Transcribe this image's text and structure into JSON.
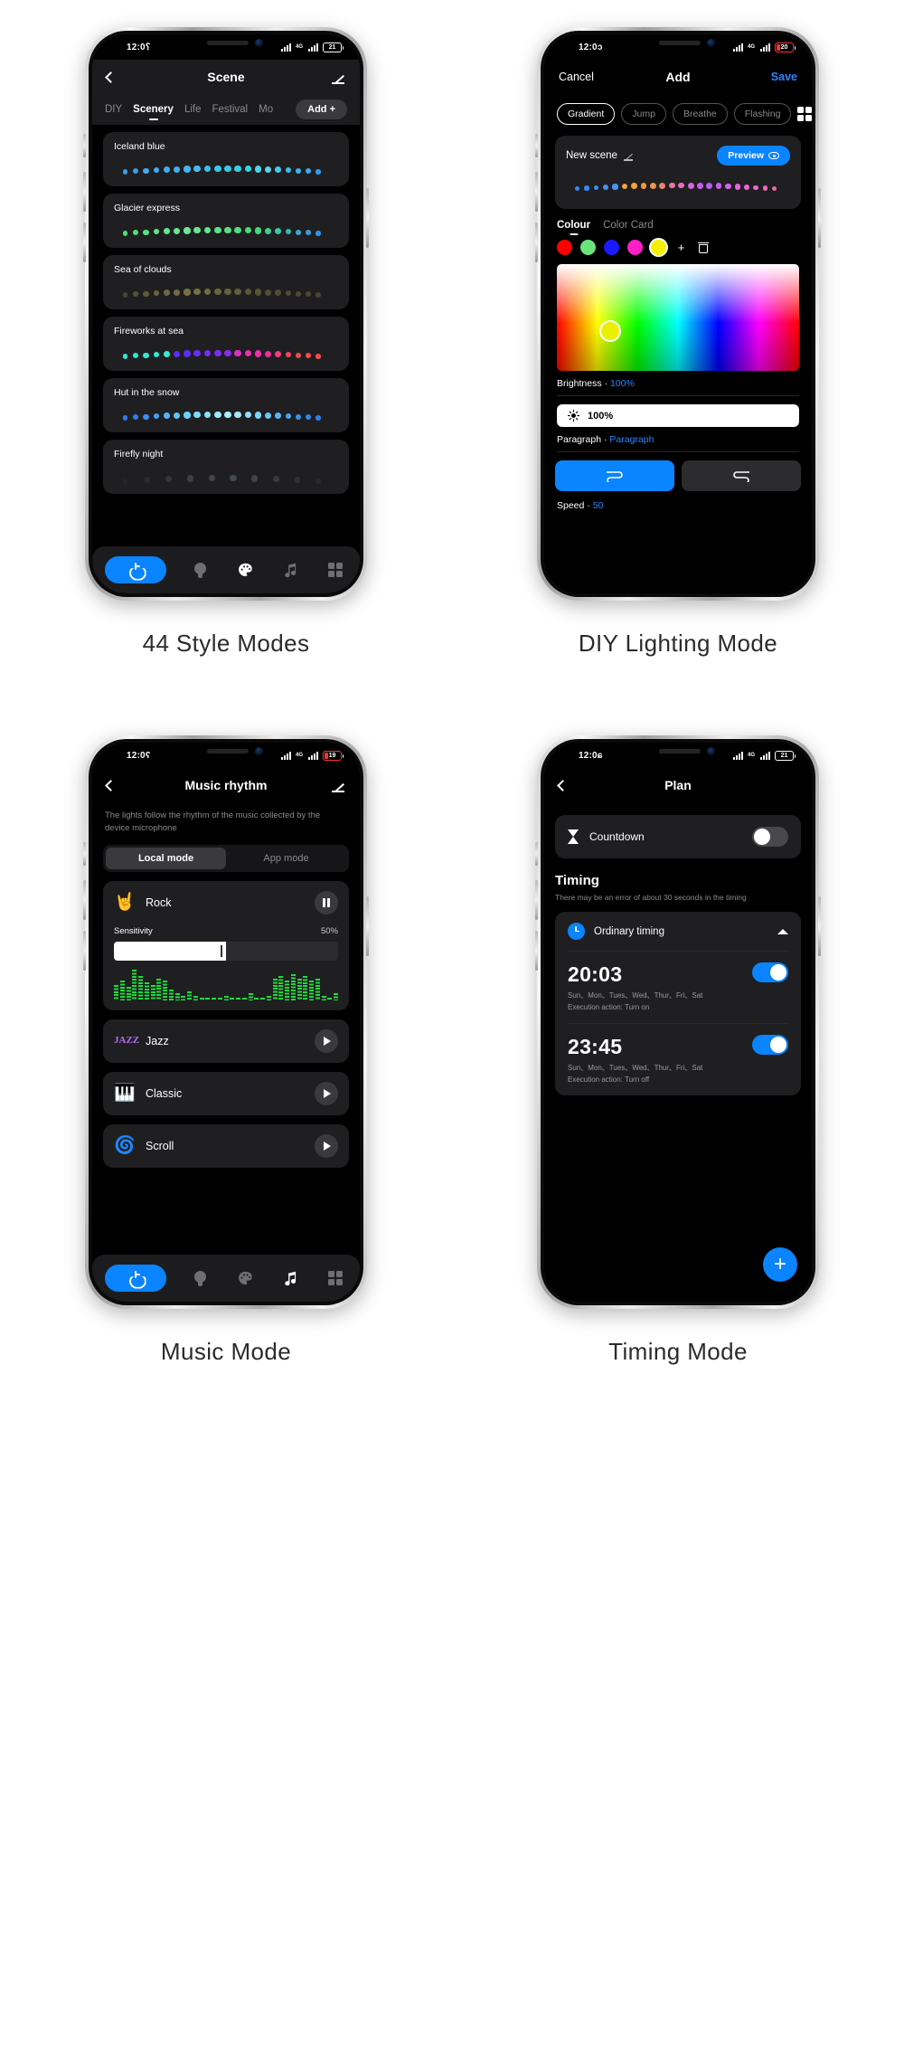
{
  "captions": {
    "p1": "44 Style Modes",
    "p2": "DIY Lighting Mode",
    "p3": "Music Mode",
    "p4": "Timing Mode"
  },
  "phone1": {
    "status": {
      "time": "12:0⸮",
      "net1": "4G",
      "net2": "4G",
      "battery": "21"
    },
    "nav": {
      "title": "Scene",
      "back_icon": "chevron-left-icon",
      "edit_icon": "pencil-icon"
    },
    "tabs": [
      {
        "label": "DIY",
        "active": false
      },
      {
        "label": "Scenery",
        "active": true
      },
      {
        "label": "Life",
        "active": false
      },
      {
        "label": "Festival",
        "active": false
      },
      {
        "label": "Mo",
        "active": false
      }
    ],
    "add_button": "Add +",
    "scenes": [
      {
        "name": "Iceland blue",
        "colors": [
          "#3a9de0",
          "#3a9de0",
          "#44a8e8",
          "#3fa9f0",
          "#43aaf0",
          "#43b1f2",
          "#45b4f2",
          "#4ab9f2",
          "#41bdf0",
          "#3ec4ef",
          "#36cbec",
          "#33d2ea",
          "#2fd8e8",
          "#4ad6ea",
          "#5bd4ee",
          "#46c8f2",
          "#39bdf5",
          "#3bb5f6",
          "#3ca8f7",
          "#2f9cf8"
        ]
      },
      {
        "name": "Glacier express",
        "colors": [
          "#4ade7a",
          "#4ade7a",
          "#55e184",
          "#5ee48b",
          "#62e58f",
          "#66e692",
          "#6ae795",
          "#68e693",
          "#63e48e",
          "#5ce289",
          "#55e084",
          "#4ede7f",
          "#47dc7a",
          "#41d97c",
          "#3ed08c",
          "#3cc59e",
          "#3ab6b6",
          "#38a8ce",
          "#369ae0",
          "#2f93f0"
        ]
      },
      {
        "name": "Sea of clouds",
        "colors": [
          "#4a4635",
          "#565138",
          "#605a3c",
          "#6a633f",
          "#6f6741",
          "#736b43",
          "#767044",
          "#747044",
          "#6f6b42",
          "#6a663f",
          "#65613c",
          "#5f5c3a",
          "#5a5737",
          "#565334",
          "#534f32",
          "#514d31",
          "#4f4b30",
          "#4d4930",
          "#4b4730",
          "#494530"
        ]
      },
      {
        "name": "Fireworks at sea",
        "colors": [
          "#2fe6d6",
          "#2fe6d6",
          "#33e8d2",
          "#35e9cf",
          "#38ebcb",
          "#5b2ef5",
          "#5b2ef5",
          "#6a2ef2",
          "#742ef0",
          "#7a2eef",
          "#8a2ee8",
          "#e22ec0",
          "#ec2eb4",
          "#ef2ea8",
          "#f12e9c",
          "#f33a7e",
          "#f54362",
          "#f6484f",
          "#f74b45",
          "#f74b45"
        ]
      },
      {
        "name": "Hut in the snow",
        "colors": [
          "#2f7ef0",
          "#2f7ef0",
          "#3a90f2",
          "#46a2f4",
          "#52b4f6",
          "#5ec6f8",
          "#6ad3fa",
          "#78ddfb",
          "#88e4fc",
          "#9aeafd",
          "#a8effd",
          "#9fe9fc",
          "#8fe0fa",
          "#7dd4f8",
          "#6ac6f6",
          "#57b6f4",
          "#46a6f2",
          "#3996f0",
          "#3086ee",
          "#2f7ef0"
        ]
      },
      {
        "name": "Firefly night",
        "colors": [
          "#23262b",
          "#2a2e33",
          "#32373d",
          "#3a4047",
          "#3f464e",
          "#424a52",
          "#3d444c",
          "#353b42",
          "#2d3238",
          "#262a2f"
        ]
      }
    ],
    "tabbar": [
      {
        "icon": "power-icon",
        "active": true
      },
      {
        "icon": "bulb-icon",
        "active": false
      },
      {
        "icon": "palette-icon",
        "active": true
      },
      {
        "icon": "music-note-icon",
        "active": false
      },
      {
        "icon": "grid-icon",
        "active": false
      }
    ]
  },
  "phone2": {
    "status": {
      "time": "12:0ɔ",
      "net1": "4G",
      "net2": "4G",
      "battery": "20"
    },
    "nav": {
      "cancel": "Cancel",
      "title": "Add",
      "save": "Save"
    },
    "modes": [
      {
        "label": "Gradient",
        "active": true
      },
      {
        "label": "Jump",
        "active": false
      },
      {
        "label": "Breathe",
        "active": false
      },
      {
        "label": "Flashing",
        "active": false
      }
    ],
    "grid_icon": "grid-icon",
    "scene_panel": {
      "title": "New scene",
      "edit_icon": "pencil-icon",
      "preview_label": "Preview",
      "preview_icon": "eye-icon",
      "preview_colors": [
        "#3a86f0",
        "#3a86f0",
        "#3f8cf2",
        "#458ff4",
        "#4b93f5",
        "#f2a13c",
        "#f2a13c",
        "#f0993f",
        "#ef8f54",
        "#ee8070",
        "#ec74a0",
        "#e96cc4",
        "#d765e0",
        "#c060ec",
        "#b45ef0",
        "#c45ff0",
        "#d860ee",
        "#e861e6",
        "#f063d8",
        "#f065c8",
        "#ee67b8",
        "#ec69a8"
      ]
    },
    "color_tabs": [
      {
        "label": "Colour",
        "active": true
      },
      {
        "label": "Color Card",
        "active": false
      }
    ],
    "swatches": [
      "#ff0000",
      "#68e47a",
      "#1a1aff",
      "#ff1fc8",
      "#f5f000"
    ],
    "swatch_selected_index": 4,
    "add_swatch_icon": "plus-icon",
    "delete_swatch_icon": "trash-icon",
    "picker": {
      "handle_color": "#e9f000"
    },
    "brightness": {
      "label": "Brightness",
      "value": "100%",
      "field_value": "100%",
      "icon": "sun-icon"
    },
    "paragraph": {
      "label": "Paragraph",
      "value": "Paragraph"
    },
    "segments": [
      {
        "glyph": "⋔",
        "active": true
      },
      {
        "glyph": "⇌",
        "active": false
      }
    ],
    "speed": {
      "label": "Speed",
      "value": "50"
    }
  },
  "phone3": {
    "status": {
      "time": "12:0ʕ",
      "net1": "4G",
      "net2": "4G",
      "battery": "19"
    },
    "nav": {
      "title": "Music rhythm",
      "back_icon": "chevron-left-icon",
      "edit_icon": "pencil-icon"
    },
    "description": "The lights follow the rhythm of the music collected by the device microphone",
    "modes": [
      {
        "label": "Local mode",
        "active": true
      },
      {
        "label": "App mode",
        "active": false
      }
    ],
    "tracks": [
      {
        "emoji": "🤘",
        "name": "Rock",
        "playing": true,
        "button_icon": "pause-icon"
      },
      {
        "emoji": "JAZZ",
        "name": "Jazz",
        "playing": false,
        "button_icon": "play-icon"
      },
      {
        "emoji": "🎹",
        "name": "Classic",
        "playing": false,
        "button_icon": "play-icon"
      },
      {
        "emoji": "🌀",
        "name": "Scroll",
        "playing": false,
        "button_icon": "play-icon"
      }
    ],
    "sensitivity": {
      "label": "Sensitivity",
      "value": "50%",
      "percent": 50
    },
    "eq_bars": [
      7,
      9,
      6,
      14,
      11,
      8,
      7,
      10,
      9,
      5,
      3,
      2,
      4,
      2,
      1,
      1,
      1,
      1,
      2,
      1,
      1,
      1,
      3,
      1,
      1,
      2,
      10,
      11,
      9,
      12,
      10,
      11,
      9,
      10,
      2,
      1,
      3
    ],
    "tabbar": [
      {
        "icon": "power-icon",
        "active": true
      },
      {
        "icon": "bulb-icon",
        "active": false
      },
      {
        "icon": "palette-icon",
        "active": false
      },
      {
        "icon": "music-note-icon",
        "active": true
      },
      {
        "icon": "grid-icon",
        "active": false
      }
    ]
  },
  "phone4": {
    "status": {
      "time": "12:0ɕ",
      "net1": "4G",
      "net2": "4G",
      "battery": "21"
    },
    "nav": {
      "title": "Plan",
      "back_icon": "chevron-left-icon"
    },
    "countdown": {
      "label": "Countdown",
      "icon": "hourglass-icon",
      "on": false
    },
    "timing": {
      "heading": "Timing",
      "note": "There may be an error of about 30 seconds in the timing",
      "group_title": "Ordinary timing",
      "group_icon": "clock-icon",
      "collapse_icon": "caret-up-icon",
      "entries": [
        {
          "time": "20:03",
          "days": "Sun、Mon、Tues、Wed、Thur、Fri、Sat",
          "action": "Execution action: Turn on",
          "on": true
        },
        {
          "time": "23:45",
          "days": "Sun、Mon、Tues、Wed、Thur、Fri、Sat",
          "action": "Execution action: Turn off",
          "on": true
        }
      ]
    },
    "fab": {
      "icon": "plus-icon",
      "label": "+"
    }
  }
}
